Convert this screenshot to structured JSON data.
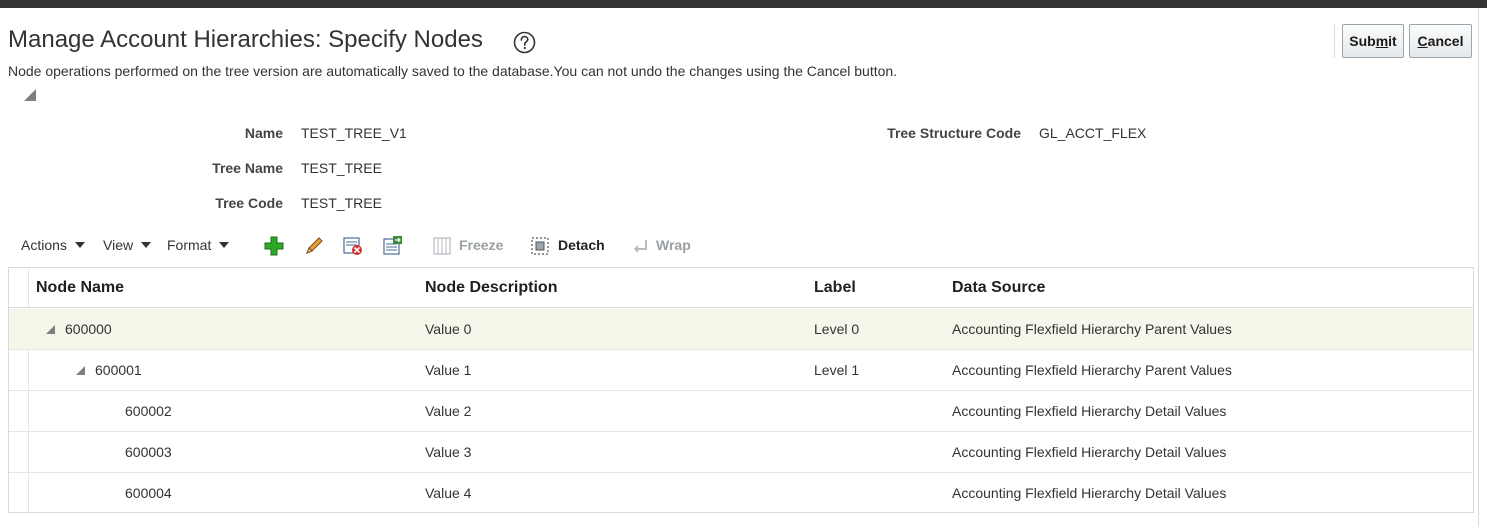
{
  "header": {
    "title": "Manage Account Hierarchies: Specify Nodes",
    "info": "Node operations performed on the tree version are automatically saved to the database.You can not undo the changes using the Cancel button.",
    "submit_label": "Submit",
    "cancel_label": "Cancel"
  },
  "fields": {
    "name_label": "Name",
    "name_value": "TEST_TREE_V1",
    "tree_name_label": "Tree Name",
    "tree_name_value": "TEST_TREE",
    "tree_code_label": "Tree Code",
    "tree_code_value": "TEST_TREE",
    "structure_label": "Tree Structure Code",
    "structure_value": "GL_ACCT_FLEX"
  },
  "toolbar": {
    "actions_label": "Actions",
    "view_label": "View",
    "format_label": "Format",
    "freeze_label": "Freeze",
    "detach_label": "Detach",
    "wrap_label": "Wrap",
    "icons": [
      "add-icon",
      "edit-icon",
      "delete-icon",
      "export-icon"
    ]
  },
  "table": {
    "columns": [
      "Node Name",
      "Node Description",
      "Label",
      "Data Source"
    ],
    "rows": [
      {
        "name": "600000",
        "description": "Value 0",
        "label": "Level 0",
        "source": "Accounting Flexfield Hierarchy Parent Values",
        "expanded": true,
        "selected": true
      },
      {
        "name": "600001",
        "description": "Value 1",
        "label": "Level 1",
        "source": "Accounting Flexfield Hierarchy Parent Values",
        "expanded": true
      },
      {
        "name": "600002",
        "description": "Value 2",
        "label": "",
        "source": "Accounting Flexfield Hierarchy Detail Values"
      },
      {
        "name": "600003",
        "description": "Value 3",
        "label": "",
        "source": "Accounting Flexfield Hierarchy Detail Values"
      },
      {
        "name": "600004",
        "description": "Value 4",
        "label": "",
        "source": "Accounting Flexfield Hierarchy Detail Values"
      }
    ]
  },
  "colors": {
    "selected_row": "#f5f7ea",
    "topbar": "#333333"
  }
}
